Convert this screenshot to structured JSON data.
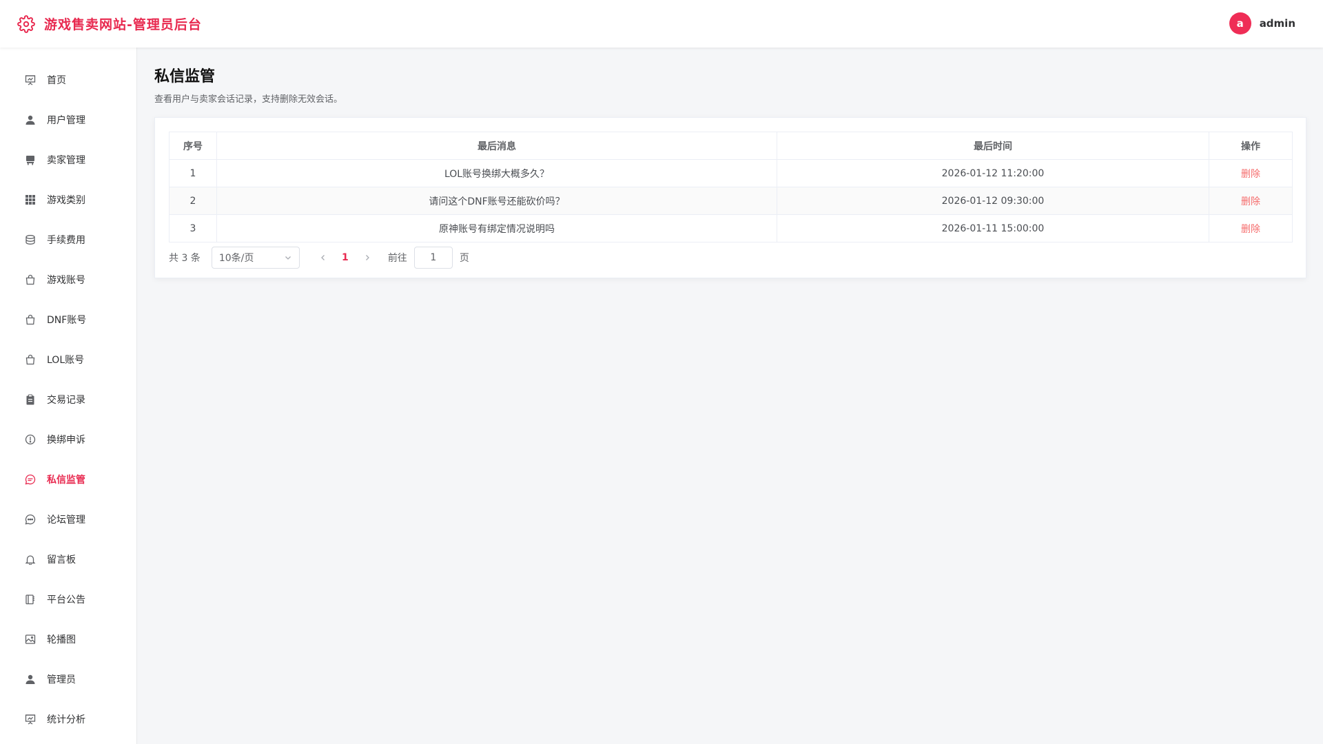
{
  "header": {
    "title": "游戏售卖网站-管理员后台",
    "user": {
      "avatar_letter": "a",
      "name": "admin"
    }
  },
  "sidebar": {
    "items": [
      {
        "label": "首页",
        "icon": "presentation-icon"
      },
      {
        "label": "用户管理",
        "icon": "user-icon"
      },
      {
        "label": "卖家管理",
        "icon": "stand-icon"
      },
      {
        "label": "游戏类别",
        "icon": "grid-icon"
      },
      {
        "label": "手续费用",
        "icon": "coins-icon"
      },
      {
        "label": "游戏账号",
        "icon": "shopping-bag-icon"
      },
      {
        "label": "DNF账号",
        "icon": "shopping-bag-icon"
      },
      {
        "label": "LOL账号",
        "icon": "shopping-bag-icon"
      },
      {
        "label": "交易记录",
        "icon": "clipboard-icon"
      },
      {
        "label": "换绑申诉",
        "icon": "warning-circle-icon"
      },
      {
        "label": "私信监管",
        "icon": "chat-bubble-icon",
        "active": true
      },
      {
        "label": "论坛管理",
        "icon": "chat-dots-icon"
      },
      {
        "label": "留言板",
        "icon": "bell-icon"
      },
      {
        "label": "平台公告",
        "icon": "notebook-icon"
      },
      {
        "label": "轮播图",
        "icon": "picture-icon"
      },
      {
        "label": "管理员",
        "icon": "user-icon"
      },
      {
        "label": "统计分析",
        "icon": "presentation-icon"
      }
    ]
  },
  "main": {
    "title": "私信监管",
    "description": "查看用户与卖家会话记录，支持删除无效会话。",
    "table": {
      "columns": [
        "序号",
        "最后消息",
        "最后时间",
        "操作"
      ],
      "rows": [
        {
          "index": "1",
          "message": "LOL账号换绑大概多久？",
          "time": "2026-01-12 11:20:00",
          "action": "删除"
        },
        {
          "index": "2",
          "message": "请问这个DNF账号还能砍价吗？",
          "time": "2026-01-12 09:30:00",
          "action": "删除"
        },
        {
          "index": "3",
          "message": "原神账号有绑定情况说明吗",
          "time": "2026-01-11 15:00:00",
          "action": "删除"
        }
      ]
    },
    "pagination": {
      "total_text": "共 3 条",
      "page_size": "10条/页",
      "current_page": "1",
      "goto_prefix": "前往",
      "goto_value": "1",
      "goto_suffix": "页"
    }
  },
  "colors": {
    "accent": "#e8294f",
    "delete": "#f56c6c"
  }
}
